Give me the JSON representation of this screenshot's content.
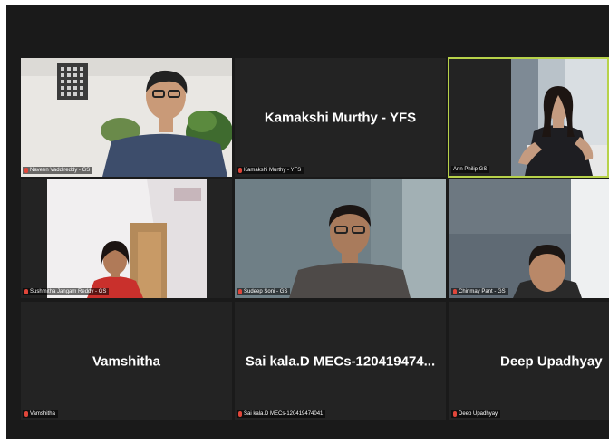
{
  "meeting": {
    "participants": [
      {
        "tile_label": "Naveen Vaddireddy - GS",
        "has_video": true,
        "muted": true,
        "active_speaker": false
      },
      {
        "display_name": "Kamakshi Murthy - YFS",
        "tile_label": "Kamakshi Murthy - YFS",
        "has_video": false,
        "muted": true,
        "active_speaker": false
      },
      {
        "tile_label": "Ann Philip GS",
        "has_video": true,
        "muted": false,
        "active_speaker": true
      },
      {
        "tile_label": "Sushmitha Jangam Reddy - GS",
        "has_video": true,
        "muted": true,
        "active_speaker": false
      },
      {
        "tile_label": "Sudeep Soni - GS",
        "has_video": true,
        "muted": true,
        "active_speaker": false
      },
      {
        "tile_label": "Chinmay Pant - GS",
        "has_video": true,
        "muted": true,
        "active_speaker": false
      },
      {
        "display_name": "Vamshitha",
        "tile_label": "Vamshitha",
        "has_video": false,
        "muted": true,
        "active_speaker": false
      },
      {
        "display_name": "Sai kala.D MECs-120419474...",
        "tile_label": "Sai kala.D MECs-120419474041",
        "has_video": false,
        "muted": true,
        "active_speaker": false
      },
      {
        "display_name": "Deep Upadhyay",
        "tile_label": "Deep Upadhyay",
        "has_video": false,
        "muted": true,
        "active_speaker": false
      }
    ]
  },
  "colors": {
    "background": "#1a1a1a",
    "tile": "#232323",
    "active_border": "#b7d24a",
    "muted_icon": "#e0463a"
  }
}
